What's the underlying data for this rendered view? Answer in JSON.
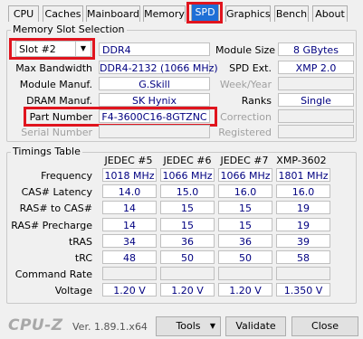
{
  "tabs": [
    "CPU",
    "Caches",
    "Mainboard",
    "Memory",
    "SPD",
    "Graphics",
    "Bench",
    "About"
  ],
  "active_tab": "SPD",
  "slot": {
    "group_title": "Memory Slot Selection",
    "selected": "Slot #2",
    "type": "DDR4",
    "module_size_label": "Module Size",
    "module_size": "8 GBytes",
    "max_bw_label": "Max Bandwidth",
    "max_bw": "DDR4-2132 (1066 MHz)",
    "spd_ext_label": "SPD Ext.",
    "spd_ext": "XMP 2.0",
    "manuf_label": "Module Manuf.",
    "manuf": "G.Skill",
    "weekyear_label": "Week/Year",
    "dram_label": "DRAM Manuf.",
    "dram": "SK Hynix",
    "ranks_label": "Ranks",
    "ranks": "Single",
    "part_label": "Part Number",
    "part": "F4-3600C16-8GTZNC",
    "correction_label": "Correction",
    "serial_label": "Serial Number",
    "registered_label": "Registered"
  },
  "timings": {
    "group_title": "Timings Table",
    "columns": [
      "JEDEC #5",
      "JEDEC #6",
      "JEDEC #7",
      "XMP-3602"
    ],
    "rows": [
      {
        "label": "Frequency",
        "values": [
          "1018 MHz",
          "1066 MHz",
          "1066 MHz",
          "1801 MHz"
        ]
      },
      {
        "label": "CAS# Latency",
        "values": [
          "14.0",
          "15.0",
          "16.0",
          "16.0"
        ]
      },
      {
        "label": "RAS# to CAS#",
        "values": [
          "14",
          "15",
          "15",
          "19"
        ]
      },
      {
        "label": "RAS# Precharge",
        "values": [
          "14",
          "15",
          "15",
          "19"
        ]
      },
      {
        "label": "tRAS",
        "values": [
          "34",
          "36",
          "36",
          "39"
        ]
      },
      {
        "label": "tRC",
        "values": [
          "48",
          "50",
          "50",
          "58"
        ]
      },
      {
        "label": "Command Rate",
        "values": [
          "",
          "",
          "",
          ""
        ]
      },
      {
        "label": "Voltage",
        "values": [
          "1.20 V",
          "1.20 V",
          "1.20 V",
          "1.350 V"
        ]
      }
    ]
  },
  "footer": {
    "logo": "CPU-Z",
    "version": "Ver. 1.89.1.x64",
    "tools": "Tools",
    "validate": "Validate",
    "close": "Close"
  },
  "colors": {
    "highlight": "#e0141e",
    "active_tab": "#1e6fd6",
    "value_text": "#000080"
  }
}
